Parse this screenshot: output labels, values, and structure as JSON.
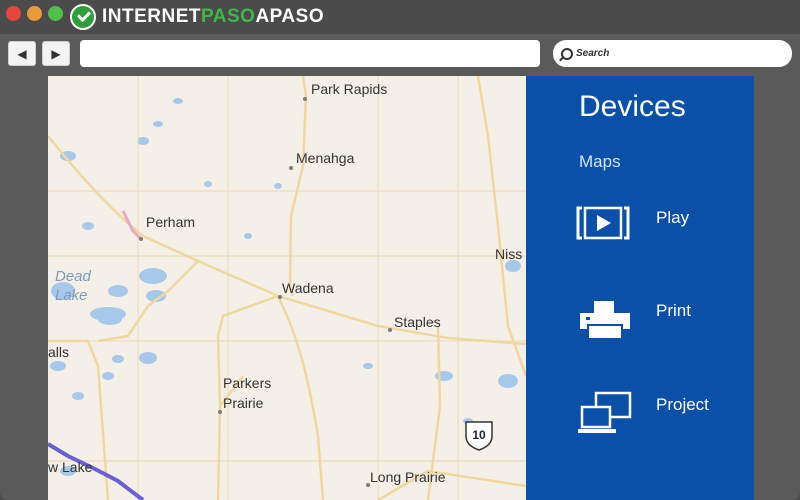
{
  "window": {
    "brand_part1": "INTERNET",
    "brand_part2": "PASO",
    "brand_part3": "APASO"
  },
  "toolbar": {
    "back_label": "◀",
    "forward_label": "▶",
    "search_placeholder": "Search"
  },
  "map": {
    "cities": [
      {
        "name": "Park Rapids",
        "id": "park-rapids"
      },
      {
        "name": "Menahga",
        "id": "menahga"
      },
      {
        "name": "Perham",
        "id": "perham"
      },
      {
        "name": "Wadena",
        "id": "wadena"
      },
      {
        "name": "Staples",
        "id": "staples"
      },
      {
        "name": "Parkers",
        "id": "parkers-line1"
      },
      {
        "name": "Prairie",
        "id": "parkers-line2"
      },
      {
        "name": "Long Prairie",
        "id": "long-prairie"
      },
      {
        "name": "Niss",
        "id": "niss"
      },
      {
        "name": "alls",
        "id": "alls"
      },
      {
        "name": "w Lake",
        "id": "w-lake"
      }
    ],
    "lake_label_line1": "Dead",
    "lake_label_line2": "Lake",
    "highway_number": "10",
    "colors": {
      "land": "#f4f0e7",
      "water": "#a7c8ea",
      "road": "#f3d9a0",
      "route": "#6b5fd6"
    }
  },
  "charms": {
    "title": "Devices",
    "app_name": "Maps",
    "items": [
      {
        "label": "Play",
        "icon": "play-to-icon"
      },
      {
        "label": "Print",
        "icon": "printer-icon"
      },
      {
        "label": "Project",
        "icon": "project-screen-icon"
      }
    ],
    "color": "#0a4fa8"
  }
}
